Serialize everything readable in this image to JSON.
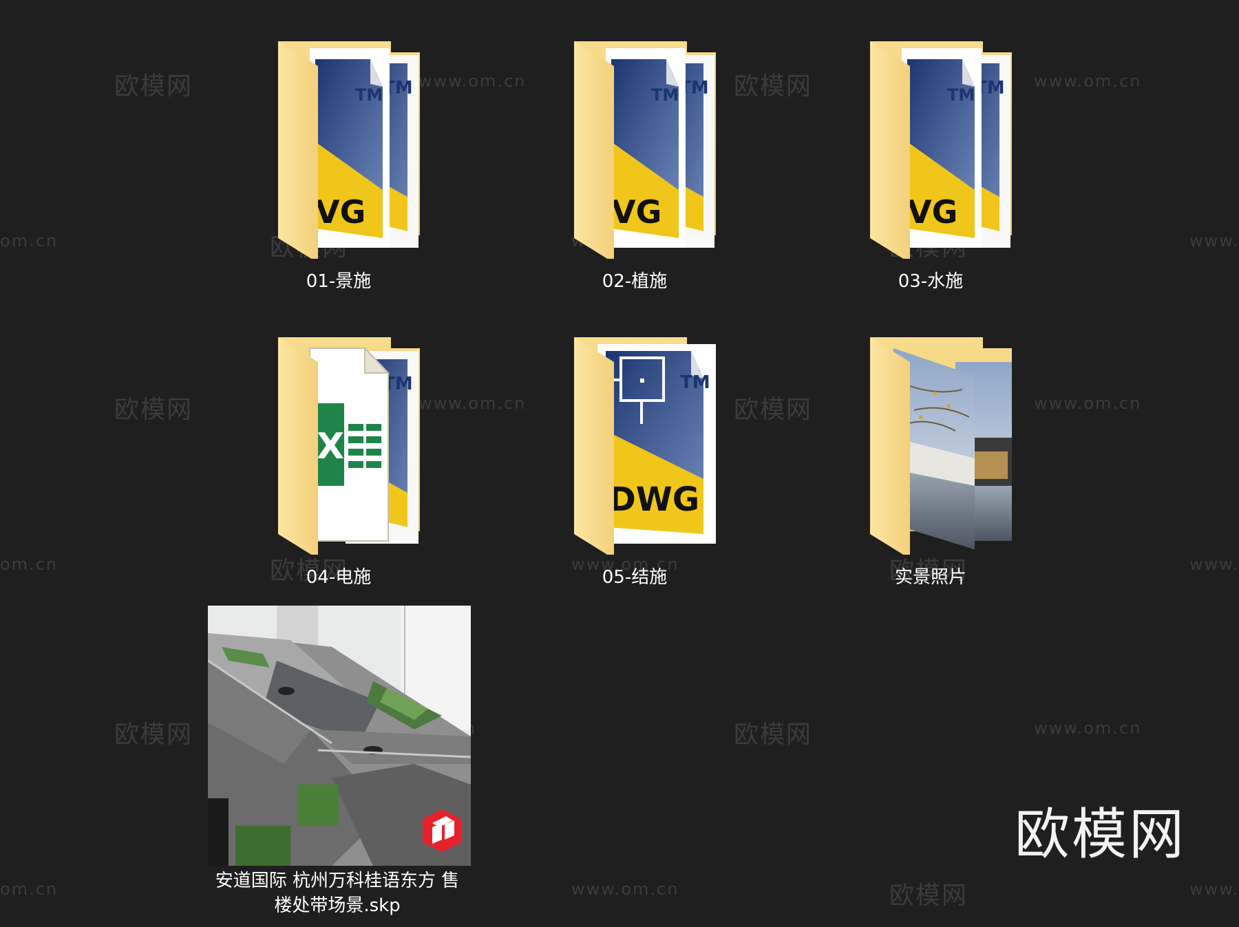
{
  "items": [
    {
      "label": "01-景施",
      "icon": "dwg-folder-icon"
    },
    {
      "label": "02-植施",
      "icon": "dwg-folder-icon"
    },
    {
      "label": "03-水施",
      "icon": "dwg-folder-icon"
    },
    {
      "label": "04-电施",
      "icon": "excel-dwg-folder-icon"
    },
    {
      "label": "05-结施",
      "icon": "dwg-folder-icon"
    },
    {
      "label": "实景照片",
      "icon": "photo-folder-icon"
    }
  ],
  "skp_file": {
    "label_line1": "安道国际 杭州万科桂语东方 售",
    "label_line2": "楼处带场景.skp",
    "icon": "sketchup-icon"
  },
  "watermarks": {
    "brand": "欧模网",
    "url": "www.om.cn",
    "url_short": "om.cn",
    "url_www": "www."
  },
  "brand_corner": "欧模网",
  "colors": {
    "background": "#1f1f1f",
    "folder": "#f5d47a",
    "folder_dark": "#e9bd52",
    "dwg_blue": "#2c4a86",
    "dwg_yellow": "#f1cc17",
    "excel_green": "#1e8449"
  }
}
